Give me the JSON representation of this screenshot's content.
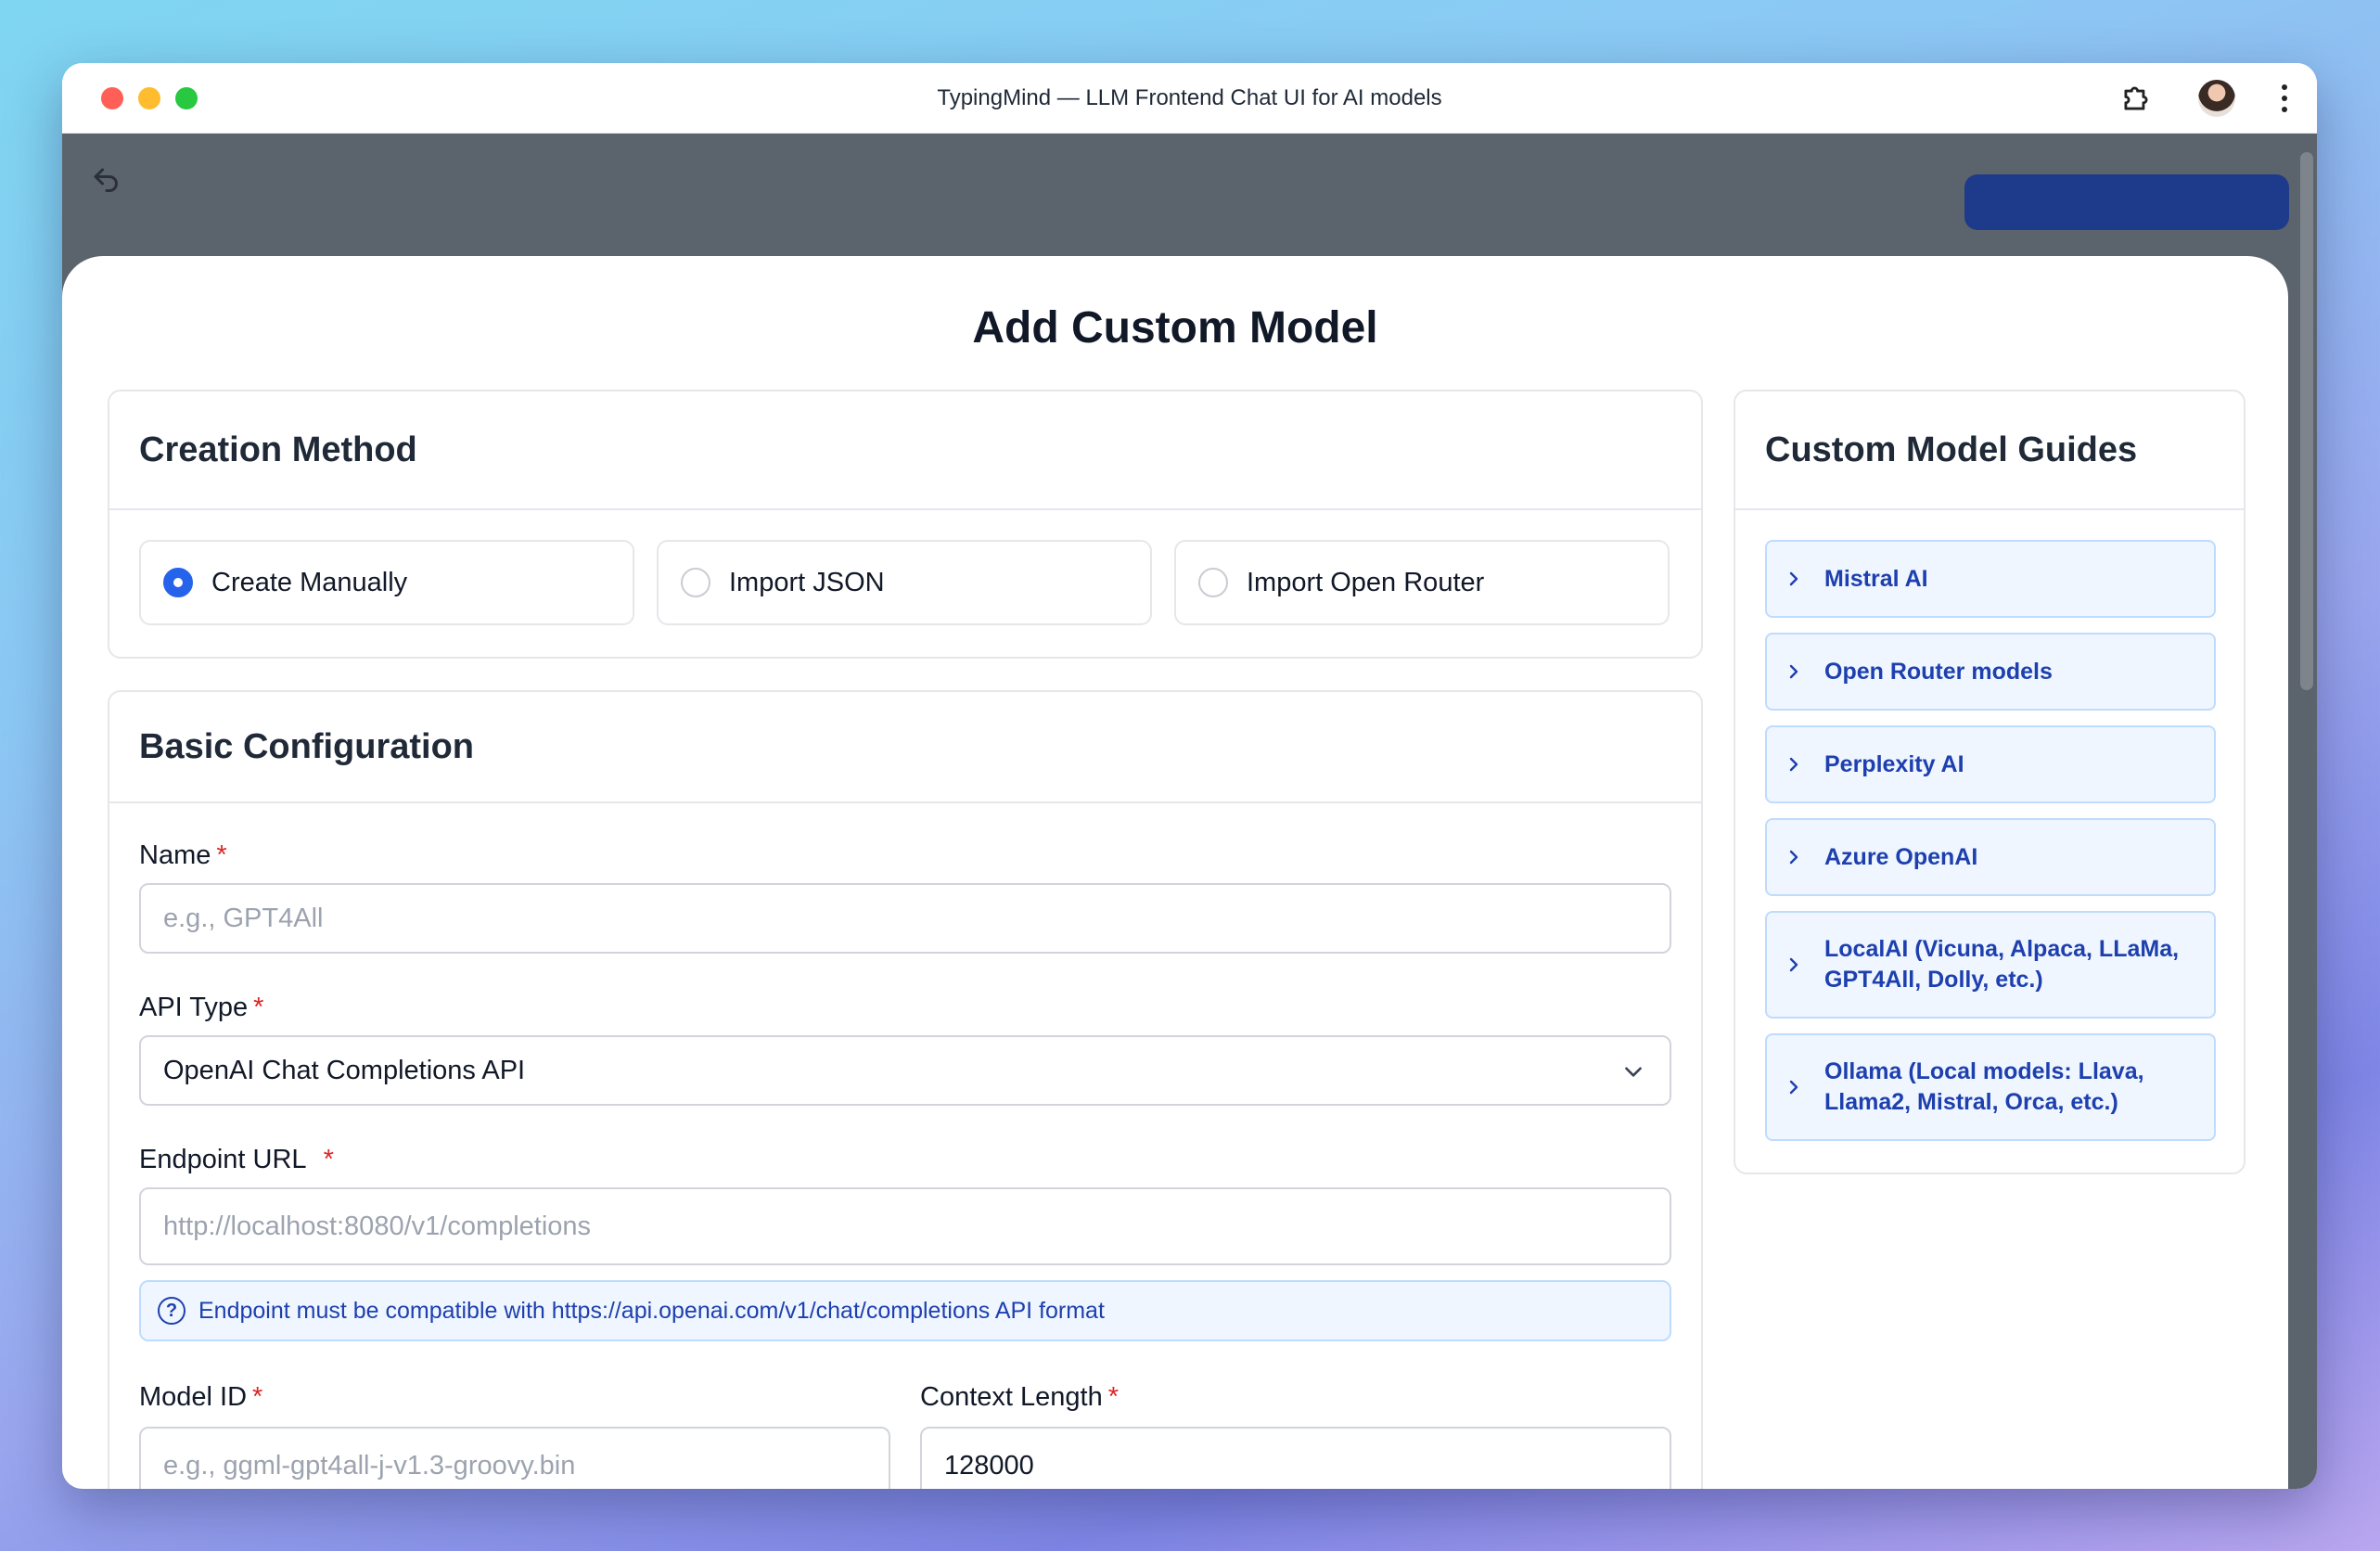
{
  "window": {
    "title": "TypingMind — LLM Frontend Chat UI for AI models"
  },
  "modal": {
    "title": "Add Custom Model"
  },
  "creation_method": {
    "heading": "Creation Method",
    "options": [
      {
        "label": "Create Manually",
        "selected": true
      },
      {
        "label": "Import JSON",
        "selected": false
      },
      {
        "label": "Import Open Router",
        "selected": false
      }
    ]
  },
  "basic_config": {
    "heading": "Basic Configuration",
    "name": {
      "label": "Name",
      "required_mark": "*",
      "value": "",
      "placeholder": "e.g., GPT4All"
    },
    "api_type": {
      "label": "API Type",
      "required_mark": "*",
      "value": "OpenAI Chat Completions API"
    },
    "endpoint": {
      "label": "Endpoint URL",
      "required_mark": "*",
      "value": "",
      "placeholder": "http://localhost:8080/v1/completions"
    },
    "endpoint_info": "Endpoint must be compatible with https://api.openai.com/v1/chat/completions API format",
    "model_id": {
      "label": "Model ID",
      "required_mark": "*",
      "value": "",
      "placeholder": "e.g., ggml-gpt4all-j-v1.3-groovy.bin"
    },
    "context_length": {
      "label": "Context Length",
      "required_mark": "*",
      "value": "128000"
    }
  },
  "guides": {
    "heading": "Custom Model Guides",
    "items": [
      {
        "label": "Mistral AI"
      },
      {
        "label": "Open Router models"
      },
      {
        "label": "Perplexity AI"
      },
      {
        "label": "Azure OpenAI"
      },
      {
        "label": "LocalAI (Vicuna, Alpaca, LLaMa, GPT4All, Dolly, etc.)"
      },
      {
        "label": "Ollama (Local models: Llava, Llama2, Mistral, Orca, etc.)"
      }
    ]
  },
  "colors": {
    "accent": "#2563eb",
    "guide_text": "#1e40af",
    "guide_bg": "#eff6ff",
    "required": "#dc2626"
  },
  "icons": [
    "extension-icon",
    "avatar",
    "more-vert-icon",
    "back-arrow-icon",
    "chevron-down-icon",
    "info-question-icon",
    "chevron-right-icon"
  ]
}
